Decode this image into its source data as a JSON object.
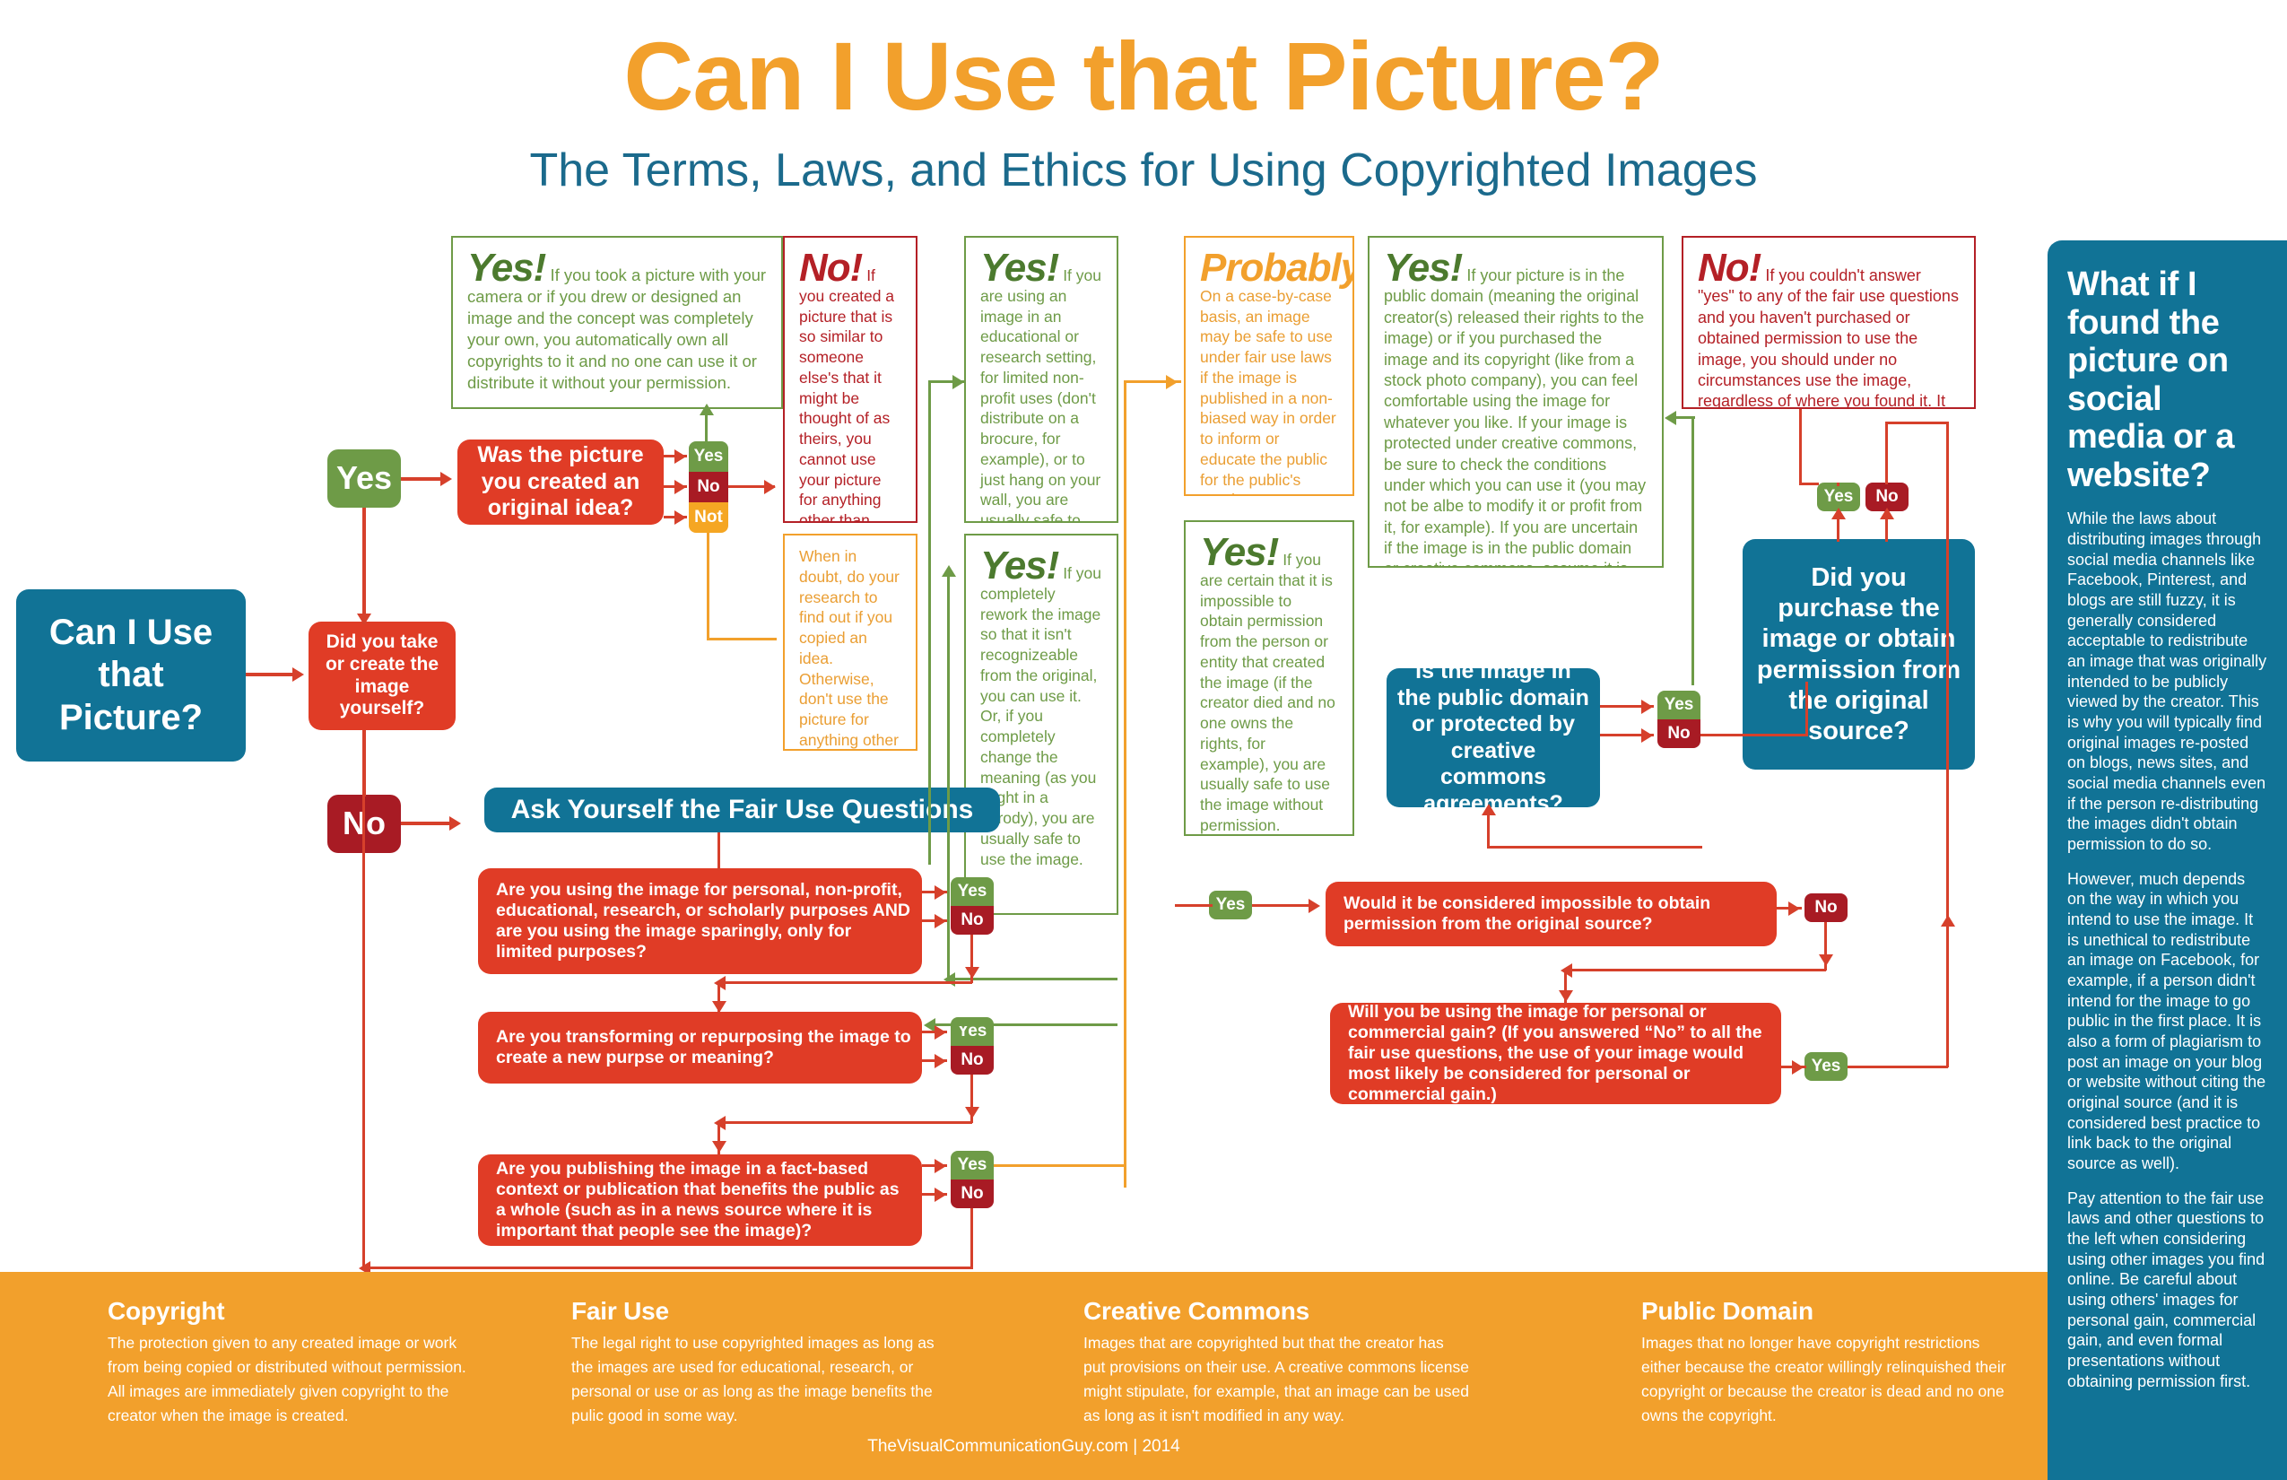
{
  "header": {
    "title": "Can I Use that Picture?",
    "subtitle": "The Terms, Laws, and Ethics for Using Copyrighted Images"
  },
  "outcomes": {
    "yes_own": {
      "lead": "Yes!",
      "body": "If you took a picture with your camera or if you drew or designed an image and the concept was completely your own, you automatically own all copyrights to it and no one can use it or distribute it without your permission."
    },
    "no_similar": {
      "lead": "No!",
      "body": "If you created a picture that is so similar to someone else's that it might be thought of as theirs, you cannot use your picture for anything other than personal use."
    },
    "when_in_doubt": {
      "lead": "",
      "body": "When in doubt, do your research to find out if you copied an idea. Otherwise, don't use the picture for anything other than limited  personal use."
    },
    "yes_educational": {
      "lead": "Yes!",
      "body": "If you are using an image in an educational or research setting, for limited non-profit uses (don't distribute on a brocure, for example), or to just hang on your wall, you are usually safe to use the image without permission."
    },
    "yes_rework": {
      "lead": "Yes!",
      "body": "If you completely rework the image so that it isn't recognizeable from the original, you can use it. Or, if you completely change the meaning (as you might in a parody), you are usually safe to use the image."
    },
    "probably": {
      "lead": "Probably.",
      "body": "On a case-by-case basis, an image may be safe to use under fair use laws if the image is published in a non-biased way in order to inform or educate the public for the public's good."
    },
    "yes_impossible": {
      "lead": "Yes!",
      "body": "If you are certain that it is impossible to obtain permission from the person or entity that created the image (if the creator died and no one owns the rights, for example), you are usually safe to use the image without permission."
    },
    "yes_public_domain": {
      "lead": "Yes!",
      "body": "If your picture is in the public domain (meaning the original creator(s) released their rights to the image) or if you purchased the image and its copyright (like from a stock photo company), you can feel comfortable using the image for whatever you like. If your image is protected under creative commons, be sure to check the conditions under which you can use it (you may not be albe to modify it or profit from it, for example). If you are uncertain if the image is in the public domain or creative commons, assume it is not and avoid using it until you've obtained permission."
    },
    "no_final": {
      "lead": "No!",
      "body": "If you couldn't answer \"yes\" to any of the fair use questions and you haven't purchased or obtained permission to use the image, you should under no circumstances use the image, regardless of where you found it. It is not only considered unethical to use another person's or company's image without permission, it is illegal."
    }
  },
  "flow": {
    "start": "Can I Use that Picture?",
    "q_take_create": "Did you take or create the image yourself?",
    "q_original_idea": "Was the picture you created an original idea?",
    "fair_use_header": "Ask Yourself the Fair Use Questions",
    "q_fairuse_1": "Are you using the image for personal, non-profit, educational, research, or scholarly purposes AND are you using the image sparingly, only for limited purposes?",
    "q_fairuse_2": "Are you transforming or repurposing the image to create a new purpse or meaning?",
    "q_fairuse_3": "Are you publishing the image in a fact-based context or publication that benefits the public as a whole (such as in a news source where it is important that people see the image)?",
    "q_public_domain": "Is the image in the public domain or protected by creative commons agreements?",
    "q_impossible": "Would it be considered impossible to obtain permission from the original source?",
    "q_gain": "Will you be using the image for personal or commercial gain? (If you answered “No” to all the fair use questions, the use of your image would most likely be considered for personal or commercial gain.)",
    "q_purchase": "Did you purchase the image or obtain permission from the original source?",
    "labels": {
      "yes": "Yes",
      "no": "No",
      "not": "Not",
      "yes_big": "Yes",
      "no_big": "No"
    }
  },
  "sidebar": {
    "heading": "What if I found the picture on social media or a website?",
    "p1": "While the laws about distributing images through social media channels like Facebook, Pinterest, and blogs are still fuzzy, it is generally considered acceptable to redistribute an image that was originally intended to be publicly viewed by the creator. This is why you will typically find original images re-posted on blogs, news sites, and social media channels even if the person re-distributing the images didn't obtain permission to do so.",
    "p2": "However, much depends on the way in which you intend to use the image. It is unethical to redistribute an image on Facebook, for example, if a person didn't intend for the image to go public in the first place. It is also a form of plagiarism to post an image on your blog or website without citing the original source (and it is considered best practice to link back to the original source as well).",
    "p3": "Pay attention to the fair use laws and other questions to the left when considering using other images you find online. Be careful about using others' images for personal gain, commercial gain, and even formal presentations without obtaining permission first."
  },
  "footer": {
    "columns": [
      {
        "title": "Copyright",
        "text": "The protection given to any created image or work from being copied or distributed without permission. All images are immediately given copyright to the creator when the image is created."
      },
      {
        "title": "Fair Use",
        "text": "The legal right to use copyrighted images as long as the images are used for educational, research, or personal or use or as long as the image benefits the pulic good in some way."
      },
      {
        "title": "Creative Commons",
        "text": "Images that are copyrighted but that the creator has put provisions on their use. A creative commons license might stipulate, for example, that an image can be used as long as it isn't modified in any way."
      },
      {
        "title": "Public Domain",
        "text": "Images that no longer have copyright restrictions either because the creator willingly relinquished their copyright or because the creator is dead and no one owns the copyright."
      }
    ],
    "credit": "TheVisualCommunicationGuy.com | 2014"
  },
  "colors": {
    "orange": "#F2A02C",
    "teal": "#117396",
    "red": "#E03C26",
    "dark_red": "#A81B24",
    "green": "#6E9B47",
    "dark_green": "#4C7A2E"
  }
}
